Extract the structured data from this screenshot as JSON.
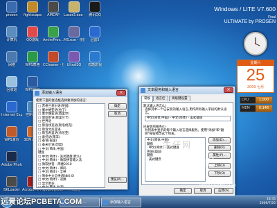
{
  "desktop": {
    "icons": [
      {
        "label": "prosen",
        "color": "#3a6bb0"
      },
      {
        "label": "fightscape",
        "color": "#c08a2a"
      },
      {
        "label": "AMCAP",
        "color": "#4a4a4a"
      },
      {
        "label": "Luxor3.exe - 快捷方式",
        "color": "#c9b36a"
      },
      {
        "label": "腾讯QQ",
        "color": "#1a1a1a"
      },
      {
        "label": "计算机",
        "color": "#5b8dbe"
      },
      {
        "label": "QQ游戏",
        "color": "#e04a4a"
      },
      {
        "label": "AmimProv... - 快捷方式",
        "color": "#3aa04a"
      },
      {
        "label": "MS.exe - 快捷方式",
        "color": "#6a6aa0"
      },
      {
        "label": "迅雷5",
        "color": "#2a6ad0"
      },
      {
        "label": "网络",
        "color": "#4a7ab0"
      },
      {
        "label": "WPS表格",
        "color": "#2a9a4a"
      },
      {
        "label": "CCleaner - 快捷方式",
        "color": "#c04a2a"
      },
      {
        "label": "UltraISO",
        "color": "#7a5ab0"
      },
      {
        "label": "优酷影视",
        "color": "#2a7ad0"
      },
      {
        "label": "回收站",
        "color": "#9ac0e0"
      },
      {
        "label": "WPS文字",
        "color": "#2a5aa0"
      },
      {
        "label": "Internet Explorer",
        "color": "#2a6ad0"
      },
      {
        "label": "控制面板",
        "color": "#4a8ac0"
      },
      {
        "label": "WPS演示",
        "color": "#c05a2a"
      },
      {
        "label": "3DMark06",
        "color": "#d06a2a"
      },
      {
        "label": "Adobe Photosh...",
        "color": "#1a2a4a"
      },
      {
        "label": "BKLoader",
        "color": "#4a4a4a"
      },
      {
        "label": "Acrobat 8 Professional",
        "color": "#a02020"
      },
      {
        "label": "gdiplug.exe - 快捷方式",
        "color": "#6a6a6a"
      },
      {
        "label": "PPS影音",
        "color": "#3aa03a"
      }
    ],
    "banner": {
      "line1": "Windows / LITE V7.600",
      "line1_suffix": "Final",
      "line2": "ULTIMATE by PROSEN"
    },
    "calendar": {
      "weekday": "星期六",
      "day": "25",
      "month": "2009 七月"
    },
    "meters": [
      {
        "label": "CPU",
        "value": "1.000"
      },
      {
        "label": "MEM",
        "value": "0.146"
      }
    ]
  },
  "dialog_left": {
    "title": "添加输入语言",
    "instruction": "使用下面的复选框选择要添加的语言:",
    "tree": [
      "□ 苏格兰盖尔语(英国)",
      "□ 塞尔维亚语(拉丁)",
      "□ 塞尔维亚语(西里尔)",
      "□ 僧伽罗语(斯里兰卡)",
      "□ 世界语",
      "□ 斯洛伐克语(斯洛伐克)",
      "□ 斯洛文尼亚语",
      "□ 斯瓦希里语(肯尼亚)",
      "□ 索托语(南非)",
      "□ 泰语(泰国)",
      "□ 泰米尔语(印度)",
      "□ 中文(简体,中国)",
      "   键盘",
      "   □ 中文(简体) - 美式键盘(默认)",
      "   □ 中文(简体) - 微软拼音输入法",
      "   □ 微软拼音 - 简捷2010",
      "   □ 中文(简体) - 郑码",
      "   □ 中文(简体) - 全拼",
      "   □ 简体中文全拼(版本6.0)",
      "   □ 中文(简体) - 双拼",
      "   □ 显示更多...",
      "□ 中文(繁体,台湾)"
    ],
    "buttons": {
      "ok": "确定",
      "cancel": "取消",
      "preview": "预览(P)..."
    }
  },
  "dialog_right": {
    "title": "文本服务和输入语言",
    "tabs": [
      "常规",
      "语言栏",
      "高级键设置"
    ],
    "default_lang_label": "默认输入语言(L)",
    "default_lang_desc": "选择其中一个已安装的输入语言,用作所有输入字段的默认语言。",
    "default_lang_value": "中文(简体,中国) - 中文(简体) - 美式键盘",
    "installed_label": "已安装的服务(I)",
    "installed_desc": "为列表中显示的每个输入语言选择服务。使用\"添加\"和\"删除\"按钮修改这个列表。",
    "tree": [
      "中文(简体,中国)",
      "键盘",
      "· 中文(简体) - 美式键盘",
      "英语(美国)",
      "键盘",
      "· 美式键盘"
    ],
    "side_buttons": {
      "add": "添加(D)...",
      "remove": "删除(R)",
      "properties": "属性(P)...",
      "up": "上移(U)",
      "down": "下移(O)"
    },
    "buttons": {
      "ok": "确定",
      "cancel": "取消",
      "apply": "应用(A)"
    }
  },
  "taskbar": {
    "items": [
      {
        "label": "文本服务..."
      },
      {
        "label": "添加输入语言"
      }
    ],
    "time": "18:35",
    "date": "2009/7/25"
  },
  "watermarks": {
    "left": "远景论坛PCBETA.COM",
    "url": "www.niuseo.com",
    "script": "Hontine",
    "shadow": "牛仔网"
  }
}
